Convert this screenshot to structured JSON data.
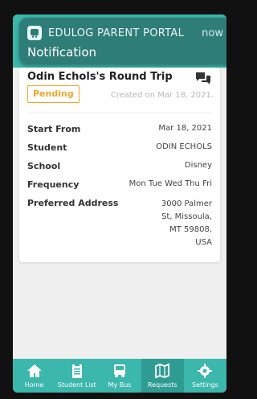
{
  "notification": {
    "app_name": "EDULOG PARENT PORTAL",
    "time": "now",
    "title": "Notification"
  },
  "trip": {
    "title": "Odin Echols's Round Trip",
    "status": "Pending",
    "created": "Created on Mar 18, 2021.",
    "details": [
      {
        "label": "Start From",
        "value": "Mar 18, 2021"
      },
      {
        "label": "Student",
        "value": "ODIN ECHOLS"
      },
      {
        "label": "School",
        "value": "Disney"
      },
      {
        "label": "Frequency",
        "value": "Mon Tue Wed Thu Fri"
      },
      {
        "label": "Preferred Address",
        "value_lines": [
          "3000 Palmer",
          "St, Missoula,",
          "MT 59808,",
          "USA"
        ]
      }
    ]
  },
  "tabs": [
    {
      "label": "Home",
      "icon": "home-icon"
    },
    {
      "label": "Student List",
      "icon": "clipboard-icon"
    },
    {
      "label": "My Bus",
      "icon": "bus-icon"
    },
    {
      "label": "Requests",
      "icon": "map-icon",
      "active": true
    },
    {
      "label": "Settings",
      "icon": "gear-icon"
    }
  ],
  "colors": {
    "teal": "#3bb7ac",
    "teal_dark": "#2f7d78",
    "pending": "#f3a52a"
  }
}
